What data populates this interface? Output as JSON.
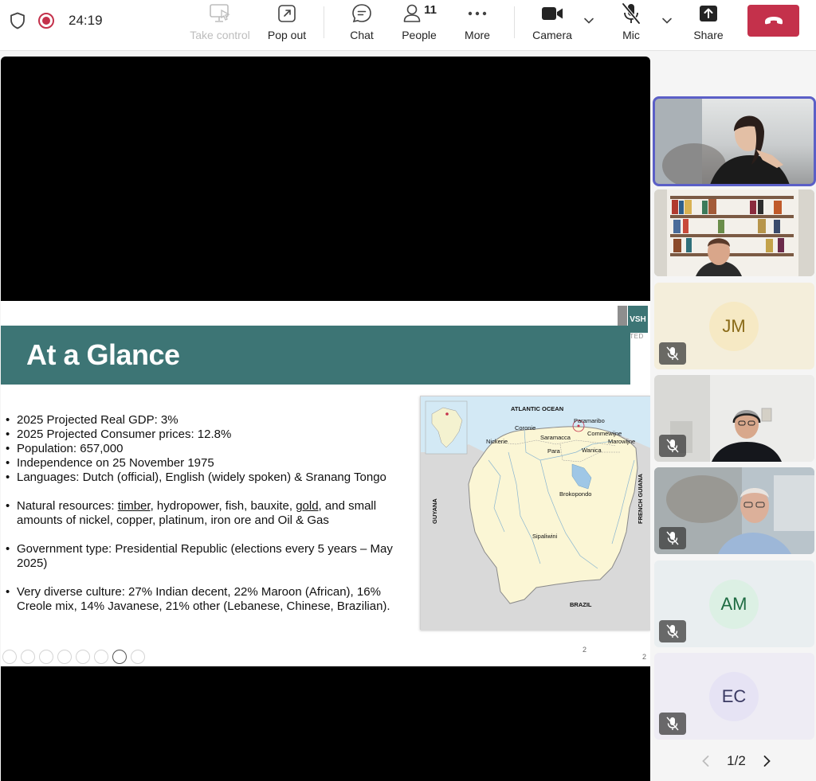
{
  "meeting": {
    "elapsed": "24:19"
  },
  "toolbar": {
    "take_control": "Take control",
    "pop_out": "Pop out",
    "chat": "Chat",
    "people_label": "People",
    "people_count": "11",
    "more": "More",
    "camera": "Camera",
    "mic": "Mic",
    "share": "Share",
    "icons": [
      "shield-icon",
      "record-icon",
      "monitor-pointer-icon",
      "pop-out-icon",
      "chat-bubble-icon",
      "person-icon",
      "more-dots-icon",
      "camera-icon",
      "mic-off-icon",
      "share-icon",
      "phone-hangup-icon"
    ]
  },
  "slide": {
    "title": "At a Glance",
    "logo_text": "VSH",
    "logo_sub": "UNITED",
    "bullets": [
      "2025 Projected Real GDP: 3%",
      "2025 Projected Consumer prices: 12.8%",
      "Population: 657,000",
      "Independence on 25 November 1975",
      "Languages: Dutch (official), English (widely spoken) & Sranang Tongo"
    ],
    "resources": {
      "prefix": "Natural resources: ",
      "timber": "timber",
      "middle": ", hydropower, fish, bauxite, ",
      "gold": "gold",
      "suffix": ", and small amounts of nickel, copper, platinum, iron ore and Oil & Gas"
    },
    "government": "Government type: Presidential Republic (elections every 5 years – May 2025)",
    "culture": "Very diverse culture: 27% Indian decent, 22% Maroon (African), 16% Creole mix, 14% Javanese, 21% other (Lebanese, Chinese, Brazilian).",
    "page_number": "2",
    "page_number_outer": "2",
    "map": {
      "ocean": "ATLANTIC OCEAN",
      "guyana": "GUYANA",
      "french_guiana": "FRENCH GUIANA",
      "brazil": "BRAZIL",
      "districts": [
        "Paramaribo",
        "Coronie",
        "Saramacca",
        "Commewijne",
        "Nickerie",
        "Marowijne",
        "Para",
        "Wanica",
        "Brokopondo",
        "Sipaliwini"
      ]
    }
  },
  "participants": [
    {
      "type": "video",
      "name": "video-participant-1",
      "active": true
    },
    {
      "type": "video",
      "name": "video-participant-2"
    },
    {
      "type": "avatar",
      "initials": "JM",
      "bg": "#f4eedb",
      "circle": "#f6e9c4",
      "color": "#8a6b18",
      "muted": true
    },
    {
      "type": "video",
      "name": "video-participant-3",
      "muted": true
    },
    {
      "type": "video",
      "name": "video-participant-4",
      "muted": true
    },
    {
      "type": "avatar",
      "initials": "AM",
      "bg": "#e9eef0",
      "circle": "#dcf0e4",
      "color": "#1e6b42",
      "muted": true
    },
    {
      "type": "avatar",
      "initials": "EC",
      "bg": "#eeecf4",
      "circle": "#e6e3f4",
      "color": "#3b3a63",
      "muted": true
    }
  ],
  "pager": {
    "text": "1/2"
  },
  "colors": {
    "leave": "#c4314b",
    "active_outline": "#5b5fc7",
    "banner": "#3d7575"
  }
}
